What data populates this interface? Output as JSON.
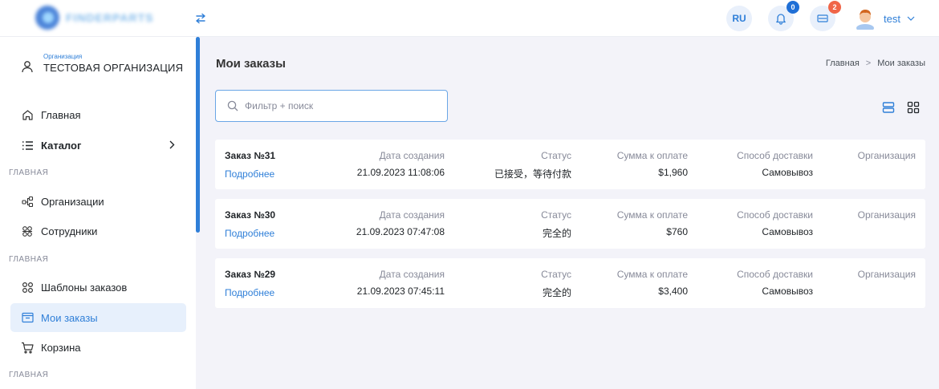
{
  "header": {
    "logo_text": "FINDERPARTS",
    "lang": "RU",
    "notifications_count": "0",
    "cart_count": "2",
    "user_name": "test"
  },
  "sidebar": {
    "org_caption": "Организация",
    "org_name": "ТЕСТОВАЯ ОРГАНИЗАЦИЯ",
    "items": {
      "home": "Главная",
      "catalog": "Каталог",
      "section1": "ГЛАВНАЯ",
      "organizations": "Организации",
      "employees": "Сотрудники",
      "section2": "ГЛАВНАЯ",
      "templates": "Шаблоны заказов",
      "my_orders": "Мои заказы",
      "cart": "Корзина",
      "section3": "ГЛАВНАЯ"
    }
  },
  "main": {
    "title": "Мои заказы",
    "breadcrumb": [
      "Главная",
      "Мои заказы"
    ],
    "search_placeholder": "Фильтр + поиск",
    "labels": {
      "date": "Дата создания",
      "status": "Статус",
      "sum": "Сумма к оплате",
      "delivery": "Способ доставки",
      "org": "Организация",
      "details": "Подробнее"
    },
    "orders": [
      {
        "title": "Заказ №31",
        "date": "21.09.2023 11:08:06",
        "status": "已接受，等待付款",
        "sum": "$1,960",
        "delivery": "Самовывоз"
      },
      {
        "title": "Заказ №30",
        "date": "21.09.2023 07:47:08",
        "status": "完全的",
        "sum": "$760",
        "delivery": "Самовывоз"
      },
      {
        "title": "Заказ №29",
        "date": "21.09.2023 07:45:11",
        "status": "完全的",
        "sum": "$3,400",
        "delivery": "Самовывоз"
      }
    ]
  },
  "colors": {
    "accent": "#2f7fd8",
    "active_bg": "#e7f0fc",
    "badge_blue": "#1f6fd6",
    "badge_red": "#f06548",
    "page_bg": "#f3f3f9"
  },
  "icons": [
    "swap-arrows-icon",
    "bell-icon",
    "cart-icon",
    "chevron-down-icon",
    "user-icon",
    "home-icon",
    "list-icon",
    "chevron-right-icon",
    "hierarchy-icon",
    "users-icon",
    "grid-icon",
    "inbox-icon",
    "basket-icon",
    "search-icon",
    "list-view-icon",
    "grid-view-icon"
  ]
}
